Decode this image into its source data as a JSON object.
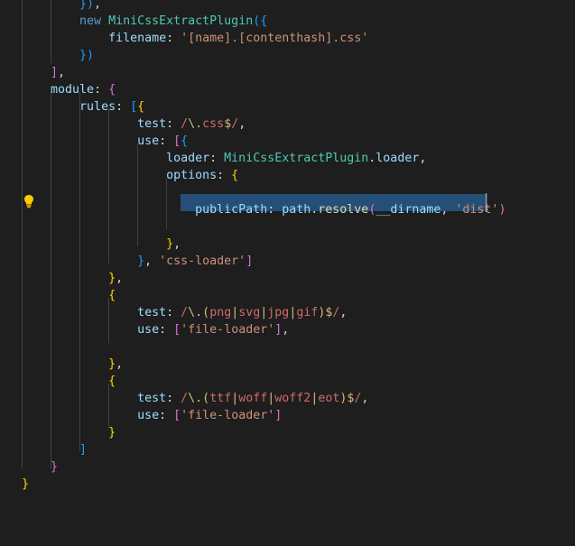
{
  "editor": {
    "theme_colors": {
      "background": "#1e1e1e",
      "selection": "#264f78",
      "indent_guide": "#404040"
    },
    "lightbulb_icon": "lightbulb-icon",
    "lines": [
      [
        {
          "t": "        ",
          "c": "w"
        },
        {
          "t": "})",
          "c": "b3"
        },
        {
          "t": ",",
          "c": "w"
        }
      ],
      [
        {
          "t": "        ",
          "c": "w"
        },
        {
          "t": "new",
          "c": "k"
        },
        {
          "t": " ",
          "c": "w"
        },
        {
          "t": "MiniCssExtractPlugin",
          "c": "cls"
        },
        {
          "t": "({",
          "c": "b3"
        }
      ],
      [
        {
          "t": "            ",
          "c": "w"
        },
        {
          "t": "filename",
          "c": "p"
        },
        {
          "t": ": ",
          "c": "w"
        },
        {
          "t": "'[name].[contenthash].css'",
          "c": "s"
        }
      ],
      [
        {
          "t": "        ",
          "c": "w"
        },
        {
          "t": "})",
          "c": "b3"
        }
      ],
      [
        {
          "t": "    ",
          "c": "w"
        },
        {
          "t": "]",
          "c": "b2"
        },
        {
          "t": ",",
          "c": "w"
        }
      ],
      [
        {
          "t": "    ",
          "c": "w"
        },
        {
          "t": "module",
          "c": "p"
        },
        {
          "t": ": ",
          "c": "w"
        },
        {
          "t": "{",
          "c": "b2"
        }
      ],
      [
        {
          "t": "        ",
          "c": "w"
        },
        {
          "t": "rules",
          "c": "p"
        },
        {
          "t": ": ",
          "c": "w"
        },
        {
          "t": "[",
          "c": "b3"
        },
        {
          "t": "{",
          "c": "b1"
        }
      ],
      [
        {
          "t": "                ",
          "c": "w"
        },
        {
          "t": "test",
          "c": "p"
        },
        {
          "t": ": ",
          "c": "w"
        },
        {
          "t": "/",
          "c": "re"
        },
        {
          "t": "\\.",
          "c": "rq"
        },
        {
          "t": "css",
          "c": "re"
        },
        {
          "t": "$",
          "c": "rq"
        },
        {
          "t": "/",
          "c": "re"
        },
        {
          "t": ",",
          "c": "w"
        }
      ],
      [
        {
          "t": "                ",
          "c": "w"
        },
        {
          "t": "use",
          "c": "p"
        },
        {
          "t": ": ",
          "c": "w"
        },
        {
          "t": "[",
          "c": "b2"
        },
        {
          "t": "{",
          "c": "b3"
        }
      ],
      [
        {
          "t": "                    ",
          "c": "w"
        },
        {
          "t": "loader",
          "c": "p"
        },
        {
          "t": ": ",
          "c": "w"
        },
        {
          "t": "MiniCssExtractPlugin",
          "c": "cls"
        },
        {
          "t": ".",
          "c": "w"
        },
        {
          "t": "loader",
          "c": "p"
        },
        {
          "t": ",",
          "c": "w"
        }
      ],
      [
        {
          "t": "                    ",
          "c": "w"
        },
        {
          "t": "options",
          "c": "p"
        },
        {
          "t": ": ",
          "c": "w"
        },
        {
          "t": "{",
          "c": "b1"
        }
      ],
      [],
      [
        {
          "t": "                        ",
          "c": "w"
        },
        {
          "t": "publicPath",
          "c": "p"
        },
        {
          "t": ": ",
          "c": "w"
        },
        {
          "t": "path",
          "c": "p"
        },
        {
          "t": ".",
          "c": "w"
        },
        {
          "t": "resolve",
          "c": "fn"
        },
        {
          "t": "(",
          "c": "b2"
        },
        {
          "t": "__dirname",
          "c": "p"
        },
        {
          "t": ", ",
          "c": "w"
        },
        {
          "t": "'dist'",
          "c": "s"
        },
        {
          "t": ")",
          "c": "b2"
        }
      ],
      [],
      [
        {
          "t": "                    ",
          "c": "w"
        },
        {
          "t": "}",
          "c": "b1"
        },
        {
          "t": ",",
          "c": "w"
        }
      ],
      [
        {
          "t": "                ",
          "c": "w"
        },
        {
          "t": "}",
          "c": "b3"
        },
        {
          "t": ", ",
          "c": "w"
        },
        {
          "t": "'css-loader'",
          "c": "s"
        },
        {
          "t": "]",
          "c": "b2"
        }
      ],
      [
        {
          "t": "            ",
          "c": "w"
        },
        {
          "t": "}",
          "c": "b1"
        },
        {
          "t": ",",
          "c": "w"
        }
      ],
      [
        {
          "t": "            ",
          "c": "w"
        },
        {
          "t": "{",
          "c": "b1"
        }
      ],
      [
        {
          "t": "                ",
          "c": "w"
        },
        {
          "t": "test",
          "c": "p"
        },
        {
          "t": ": ",
          "c": "w"
        },
        {
          "t": "/",
          "c": "re"
        },
        {
          "t": "\\.",
          "c": "rq"
        },
        {
          "t": "(",
          "c": "rq"
        },
        {
          "t": "png",
          "c": "re"
        },
        {
          "t": "|",
          "c": "rq"
        },
        {
          "t": "svg",
          "c": "re"
        },
        {
          "t": "|",
          "c": "rq"
        },
        {
          "t": "jpg",
          "c": "re"
        },
        {
          "t": "|",
          "c": "rq"
        },
        {
          "t": "gif",
          "c": "re"
        },
        {
          "t": ")",
          "c": "rq"
        },
        {
          "t": "$",
          "c": "rq"
        },
        {
          "t": "/",
          "c": "re"
        },
        {
          "t": ",",
          "c": "w"
        }
      ],
      [
        {
          "t": "                ",
          "c": "w"
        },
        {
          "t": "use",
          "c": "p"
        },
        {
          "t": ": ",
          "c": "w"
        },
        {
          "t": "[",
          "c": "b2"
        },
        {
          "t": "'file-loader'",
          "c": "s"
        },
        {
          "t": "]",
          "c": "b2"
        },
        {
          "t": ",",
          "c": "w"
        }
      ],
      [],
      [
        {
          "t": "            ",
          "c": "w"
        },
        {
          "t": "}",
          "c": "b1"
        },
        {
          "t": ",",
          "c": "w"
        }
      ],
      [
        {
          "t": "            ",
          "c": "w"
        },
        {
          "t": "{",
          "c": "b1"
        }
      ],
      [
        {
          "t": "                ",
          "c": "w"
        },
        {
          "t": "test",
          "c": "p"
        },
        {
          "t": ": ",
          "c": "w"
        },
        {
          "t": "/",
          "c": "re"
        },
        {
          "t": "\\.",
          "c": "rq"
        },
        {
          "t": "(",
          "c": "rq"
        },
        {
          "t": "ttf",
          "c": "re"
        },
        {
          "t": "|",
          "c": "rq"
        },
        {
          "t": "woff",
          "c": "re"
        },
        {
          "t": "|",
          "c": "rq"
        },
        {
          "t": "woff2",
          "c": "re"
        },
        {
          "t": "|",
          "c": "rq"
        },
        {
          "t": "eot",
          "c": "re"
        },
        {
          "t": ")",
          "c": "rq"
        },
        {
          "t": "$",
          "c": "rq"
        },
        {
          "t": "/",
          "c": "re"
        },
        {
          "t": ",",
          "c": "w"
        }
      ],
      [
        {
          "t": "                ",
          "c": "w"
        },
        {
          "t": "use",
          "c": "p"
        },
        {
          "t": ": ",
          "c": "w"
        },
        {
          "t": "[",
          "c": "b2"
        },
        {
          "t": "'file-loader'",
          "c": "s"
        },
        {
          "t": "]",
          "c": "b2"
        }
      ],
      [
        {
          "t": "            ",
          "c": "w"
        },
        {
          "t": "}",
          "c": "b1"
        }
      ],
      [
        {
          "t": "        ",
          "c": "w"
        },
        {
          "t": "]",
          "c": "b3"
        }
      ],
      [
        {
          "t": "    ",
          "c": "w"
        },
        {
          "t": "}",
          "c": "b2"
        }
      ],
      [
        {
          "t": "}",
          "c": "b1"
        }
      ]
    ]
  }
}
